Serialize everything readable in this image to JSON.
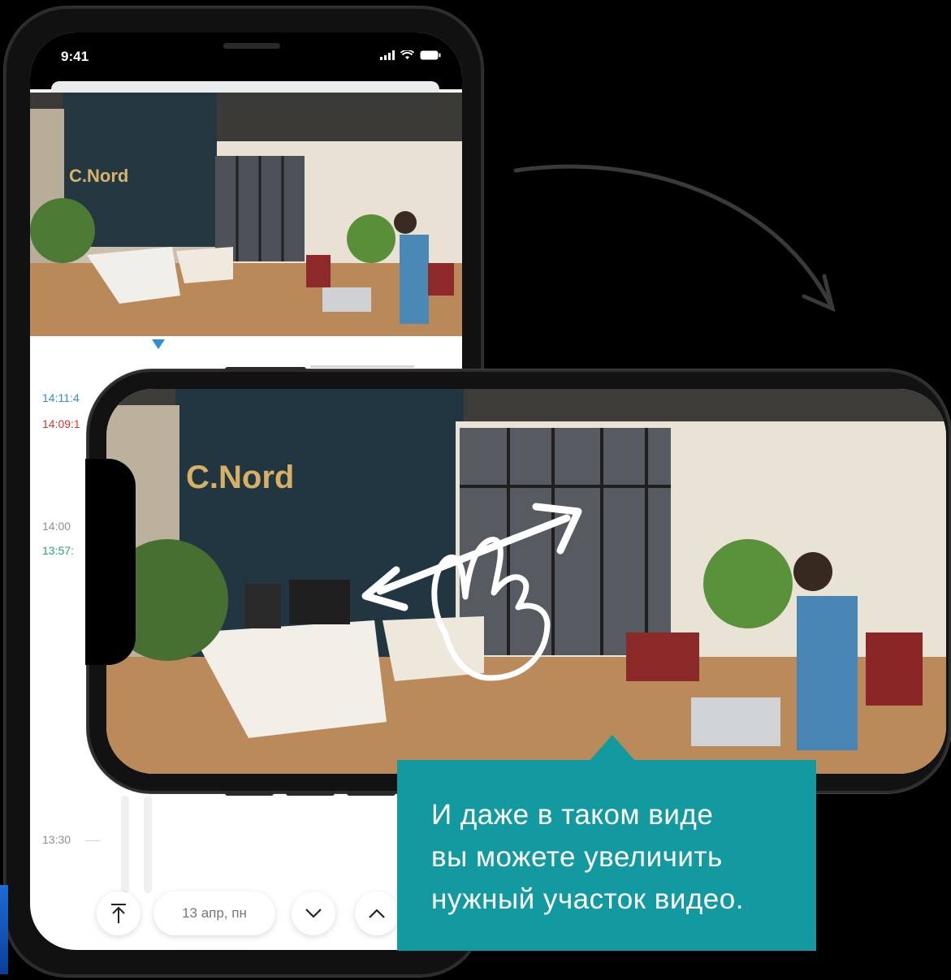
{
  "status_bar": {
    "time": "9:41"
  },
  "camera": {
    "logo_text": "C.Nord"
  },
  "timeline": {
    "events": [
      {
        "time": "14:11:4",
        "color": "blue"
      },
      {
        "time": "14:09:1",
        "color": "red"
      },
      {
        "time": "14:00",
        "color": "grey"
      },
      {
        "time": "13:57:",
        "color": "green"
      },
      {
        "time": "13:30",
        "color": "grey"
      }
    ]
  },
  "controls": {
    "date_label": "13 апр, пн",
    "icons": [
      "scroll-to-top-icon",
      "chevron-down-icon",
      "chevron-up-icon"
    ]
  },
  "callout": {
    "lines": [
      "И даже в таком виде",
      "вы можете увеличить",
      "нужный участок видео."
    ]
  },
  "colors": {
    "callout_bg": "#139aa0",
    "accent_blue": "#2c8fd6",
    "event_red": "#e0322c",
    "event_green": "#2aa37a"
  }
}
